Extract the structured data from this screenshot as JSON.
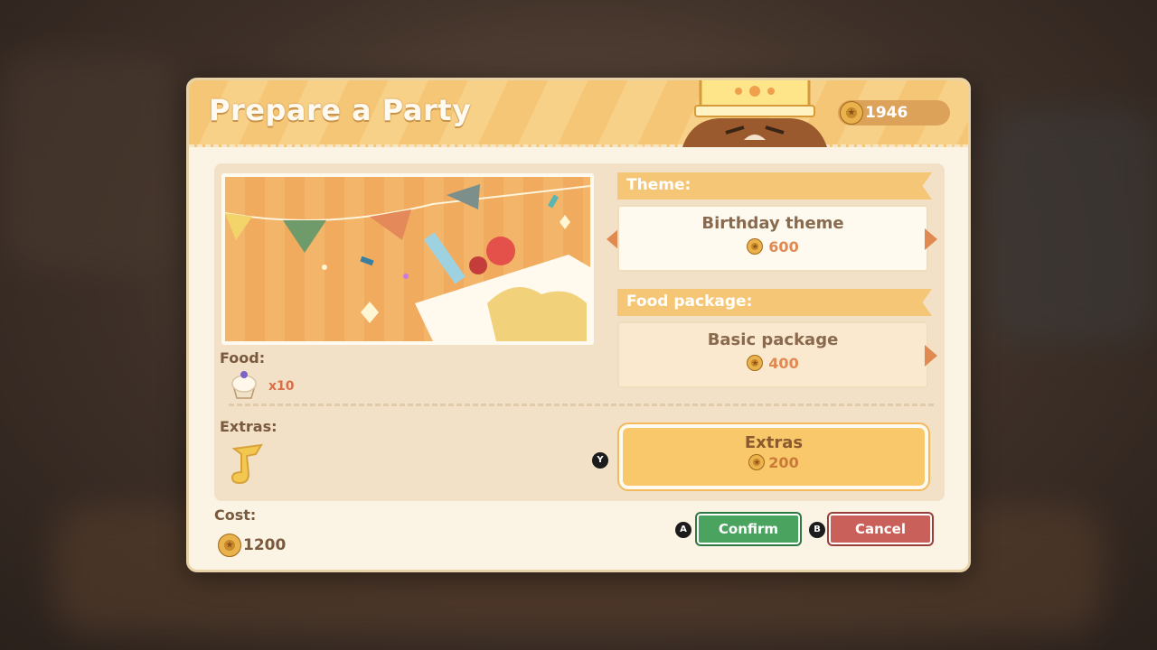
{
  "title": "Prepare a Party",
  "wallet": {
    "coins": "1946"
  },
  "food": {
    "label": "Food:",
    "count": "x10",
    "icon": "cupcake-icon"
  },
  "extras_section": {
    "label": "Extras:",
    "icon": "music-note-icon"
  },
  "theme": {
    "label": "Theme:",
    "selected": "Birthday theme",
    "price": "600"
  },
  "food_package": {
    "label": "Food package:",
    "selected": "Basic package",
    "price": "400"
  },
  "extras_button": {
    "label": "Extras",
    "price": "200",
    "shortcut": "Y"
  },
  "cost": {
    "label": "Cost:",
    "value": "1200"
  },
  "actions": {
    "confirm": {
      "label": "Confirm",
      "shortcut": "A",
      "color": "#4aa35e"
    },
    "cancel": {
      "label": "Cancel",
      "shortcut": "B",
      "color": "#c9605a"
    }
  },
  "colors": {
    "accent": "#f5c676",
    "price": "#e08a52",
    "panel": "#f2e1c7"
  }
}
